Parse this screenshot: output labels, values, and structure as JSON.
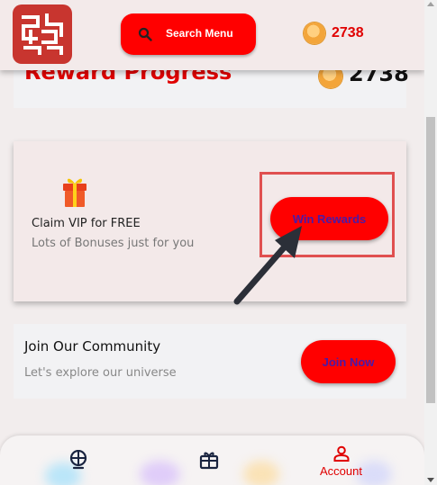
{
  "header": {
    "search_label": "Search Menu",
    "coin_balance": "2738"
  },
  "progress": {
    "title": "Reward Progress",
    "amount": "2738"
  },
  "vip": {
    "title": "Claim VIP for FREE",
    "subtitle": "Lots of Bonuses just for you",
    "button_label": "Win Rewards"
  },
  "community": {
    "title": "Join Our Community",
    "subtitle": "Let's explore our universe",
    "button_label": "Join Now"
  },
  "nav": {
    "items": [
      {
        "icon": "planet-icon",
        "label": ""
      },
      {
        "icon": "gift-card-icon",
        "label": ""
      },
      {
        "icon": "user-icon",
        "label": "Account"
      }
    ]
  },
  "colors": {
    "accent": "#ff0000",
    "text_red": "#e00000",
    "button_text": "#4a1aa8",
    "background": "#f2eded"
  }
}
